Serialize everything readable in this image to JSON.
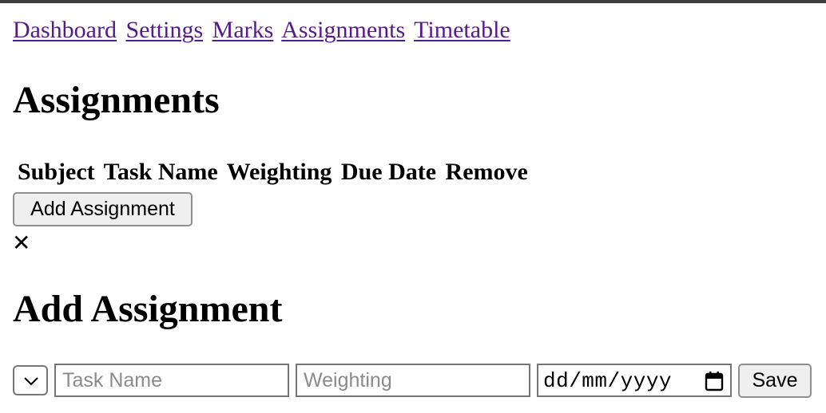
{
  "nav": {
    "links": [
      "Dashboard",
      "Settings",
      "Marks",
      "Assignments",
      "Timetable"
    ]
  },
  "page_title": "Assignments",
  "table": {
    "headers": [
      "Subject",
      "Task Name",
      "Weighting",
      "Due Date",
      "Remove"
    ]
  },
  "add_button_label": "Add Assignment",
  "close_symbol": "✕",
  "form": {
    "title": "Add Assignment",
    "subject_select": {
      "value": "",
      "icon": "chevron-down-icon"
    },
    "task_placeholder": "Task Name",
    "weighting_placeholder": "Weighting",
    "date_placeholder": "dd/mm/yyyy",
    "date_icon": "calendar-icon",
    "save_label": "Save"
  },
  "colors": {
    "link_visited": "#551a8b",
    "top_bar": "#3f3f3f",
    "button_bg": "#efefef",
    "button_border": "#8f8f8f"
  }
}
